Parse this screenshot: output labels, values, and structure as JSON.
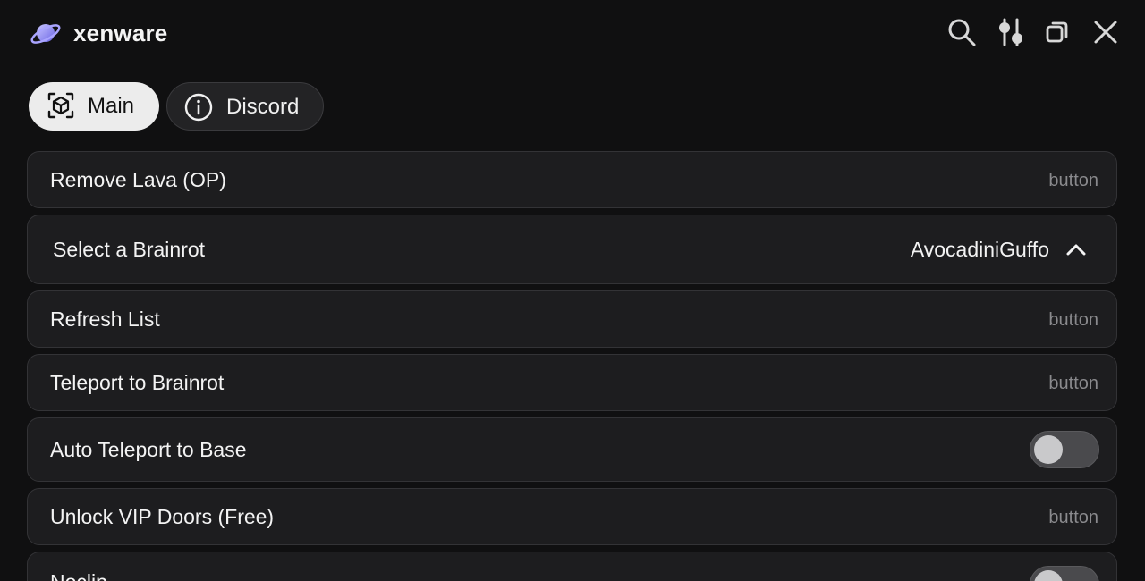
{
  "app": {
    "title": "xenware"
  },
  "header": {
    "icons": [
      "search-icon",
      "sliders-icon",
      "minimize-icon",
      "close-icon"
    ]
  },
  "tabs": [
    {
      "label": "Main",
      "icon": "cube-icon",
      "active": true
    },
    {
      "label": "Discord",
      "icon": "info-icon",
      "active": false
    }
  ],
  "rows": [
    {
      "label": "Remove Lava (OP)",
      "type": "button",
      "hint": "button"
    },
    {
      "label": "Select a Brainrot",
      "type": "dropdown",
      "value": "AvocadiniGuffo",
      "expanded": true
    },
    {
      "label": "Refresh List",
      "type": "button",
      "hint": "button"
    },
    {
      "label": "Teleport to Brainrot",
      "type": "button",
      "hint": "button"
    },
    {
      "label": "Auto Teleport to Base",
      "type": "toggle",
      "on": false
    },
    {
      "label": "Unlock VIP Doors (Free)",
      "type": "button",
      "hint": "button"
    },
    {
      "label": "Noclip",
      "type": "toggle",
      "on": false
    }
  ],
  "colors": {
    "background": "#101011",
    "row": "#1d1d1f",
    "row_border": "#333336",
    "active_tab": "#ececec",
    "hint_text": "#8a8a8d",
    "logo_accent": "#8b86f0"
  }
}
